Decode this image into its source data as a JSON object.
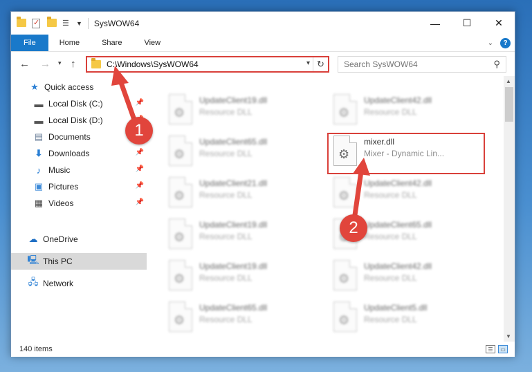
{
  "window": {
    "title": "SysWOW64",
    "controls": {
      "minimize": "—",
      "maximize": "☐",
      "close": "✕"
    }
  },
  "ribbon": {
    "tabs": [
      {
        "label": "File",
        "active": true
      },
      {
        "label": "Home"
      },
      {
        "label": "Share"
      },
      {
        "label": "View"
      }
    ],
    "help": "?"
  },
  "address": {
    "path": "C:\\Windows\\SysWOW64"
  },
  "search": {
    "placeholder": "Search SysWOW64"
  },
  "sidebar": {
    "items": [
      {
        "label": "Quick access",
        "icon": "star-icon",
        "pinned": false
      },
      {
        "label": "Local Disk (C:)",
        "icon": "drive-icon",
        "pinned": true
      },
      {
        "label": "Local Disk (D:)",
        "icon": "drive-icon",
        "pinned": true
      },
      {
        "label": "Documents",
        "icon": "documents-icon",
        "pinned": true
      },
      {
        "label": "Downloads",
        "icon": "download-icon",
        "pinned": true
      },
      {
        "label": "Music",
        "icon": "music-icon",
        "pinned": true
      },
      {
        "label": "Pictures",
        "icon": "pictures-icon",
        "pinned": true
      },
      {
        "label": "Videos",
        "icon": "videos-icon",
        "pinned": true
      },
      {
        "label": "OneDrive",
        "icon": "cloud-icon",
        "pinned": false
      },
      {
        "label": "This PC",
        "icon": "computer-icon",
        "pinned": false,
        "selected": true
      },
      {
        "label": "Network",
        "icon": "network-icon",
        "pinned": false
      }
    ]
  },
  "files": {
    "left": [
      {
        "name": "UpdateClient19.dll",
        "type": "Resource DLL"
      },
      {
        "name": "UpdateClient65.dll",
        "type": "Resource DLL"
      },
      {
        "name": "UpdateClient21.dll",
        "type": "Resource DLL"
      },
      {
        "name": "UpdateClient19.dll",
        "type": "Resource DLL"
      },
      {
        "name": "UpdateClient19.dll",
        "type": "Resource DLL"
      },
      {
        "name": "UpdateClient65.dll",
        "type": "Resource DLL"
      }
    ],
    "right": [
      {
        "name": "UpdateClient42.dll",
        "type": "Resource DLL"
      },
      {
        "name": "mixer.dll",
        "type": "Mixer - Dynamic Lin...",
        "highlighted": true
      },
      {
        "name": "UpdateClient42.dll",
        "type": "Resource DLL"
      },
      {
        "name": "UpdateClient65.dll",
        "type": "Resource DLL"
      },
      {
        "name": "UpdateClient42.dll",
        "type": "Resource DLL"
      },
      {
        "name": "UpdateClient5.dll",
        "type": "Resource DLL"
      }
    ]
  },
  "status": {
    "item_count": "140 items"
  },
  "annotations": {
    "badge1": "1",
    "badge2": "2",
    "color": "#e1453c"
  }
}
